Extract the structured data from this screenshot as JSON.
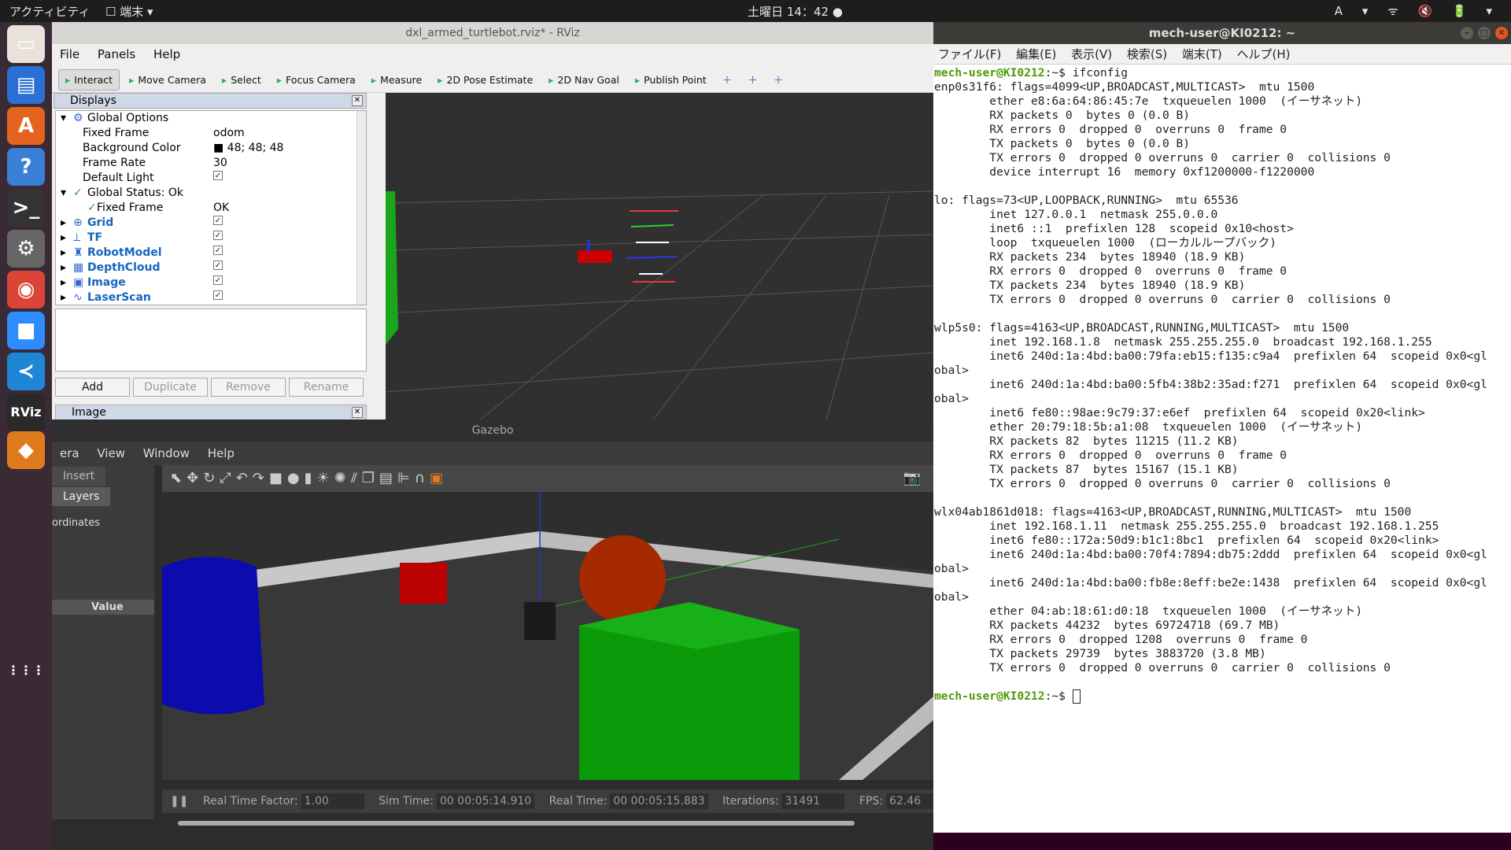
{
  "topbar": {
    "activities": "アクティビティ",
    "app": "☐ 端末 ▾",
    "clock": "土曜日 14：42 ●",
    "status": "A ▾  ᯤ 🔇 🔋 ▾"
  },
  "dock": [
    {
      "name": "files-icon",
      "g": "▭",
      "c": "#e8e2da"
    },
    {
      "name": "writer-icon",
      "g": "▤",
      "c": "#2a6fd4"
    },
    {
      "name": "software-icon",
      "g": "A",
      "c": "#e2641e"
    },
    {
      "name": "help-icon",
      "g": "?",
      "c": "#3a7fd6"
    },
    {
      "name": "terminal-icon",
      "g": ">_",
      "c": "#333"
    },
    {
      "name": "settings-icon",
      "g": "⚙",
      "c": "#666"
    },
    {
      "name": "chrome-icon",
      "g": "◉",
      "c": "#db4437"
    },
    {
      "name": "zoom-icon",
      "g": "■",
      "c": "#2d8cff"
    },
    {
      "name": "vscode-icon",
      "g": "≺",
      "c": "#1f86d6"
    },
    {
      "name": "rviz-icon",
      "g": "RViz",
      "c": "#2a2a2a"
    },
    {
      "name": "gazebo-icon",
      "g": "◆",
      "c": "#e07b1d"
    },
    {
      "name": "apps-grid-icon",
      "g": "⋮⋮⋮",
      "c": "#3a2a36"
    }
  ],
  "rviz": {
    "title": "dxl_armed_turtlebot.rviz* - RViz",
    "menu": [
      "File",
      "Panels",
      "Help"
    ],
    "tools": [
      "Interact",
      "Move Camera",
      "Select",
      "Focus Camera",
      "Measure",
      "2D Pose Estimate",
      "2D Nav Goal",
      "Publish Point"
    ],
    "tool_icons": [
      "cursor-icon",
      "move-camera-icon",
      "select-icon",
      "focus-camera-icon",
      "measure-icon",
      "pose-estimate-icon",
      "nav-goal-icon",
      "publish-point-icon"
    ],
    "displays_title": "Displays",
    "tree": [
      {
        "n": "Global Options",
        "v": "",
        "d": 0,
        "arrow": "▾",
        "icon": "⚙"
      },
      {
        "n": "Fixed Frame",
        "v": "odom",
        "d": 1
      },
      {
        "n": "Background Color",
        "v": "■ 48; 48; 48",
        "d": 1
      },
      {
        "n": "Frame Rate",
        "v": "30",
        "d": 1
      },
      {
        "n": "Default Light",
        "v": "✓",
        "d": 1,
        "chk": true
      },
      {
        "n": "Global Status: Ok",
        "v": "",
        "d": 0,
        "arrow": "▾",
        "icon": "✓"
      },
      {
        "n": "Fixed Frame",
        "v": "OK",
        "d": 1,
        "icon": "✓"
      },
      {
        "n": "Grid",
        "v": "✓",
        "d": 0,
        "arrow": "▸",
        "icon": "⊕",
        "lk": true,
        "chk": true
      },
      {
        "n": "TF",
        "v": "✓",
        "d": 0,
        "arrow": "▸",
        "icon": "⟂",
        "lk": true,
        "chk": true
      },
      {
        "n": "RobotModel",
        "v": "✓",
        "d": 0,
        "arrow": "▸",
        "icon": "♜",
        "lk": true,
        "chk": true
      },
      {
        "n": "DepthCloud",
        "v": "✓",
        "d": 0,
        "arrow": "▸",
        "icon": "▦",
        "lk": true,
        "chk": true
      },
      {
        "n": "Image",
        "v": "✓",
        "d": 0,
        "arrow": "▸",
        "icon": "▣",
        "lk": true,
        "chk": true
      },
      {
        "n": "LaserScan",
        "v": "✓",
        "d": 0,
        "arrow": "▸",
        "icon": "∿",
        "lk": true,
        "chk": true
      }
    ],
    "buttons": [
      "Add",
      "Duplicate",
      "Remove",
      "Rename"
    ],
    "image_panel": "Image"
  },
  "gazebo": {
    "title": "Gazebo",
    "menu": [
      "era",
      "View",
      "Window",
      "Help"
    ],
    "tabs": [
      "Insert",
      "Layers"
    ],
    "left_items": [
      "ordinates",
      "Value"
    ],
    "rtf_label": "Real Time Factor:",
    "rtf": "1.00",
    "sim_label": "Sim Time:",
    "sim": "00 00:05:14.910",
    "real_label": "Real Time:",
    "real": "00 00:05:15.883",
    "iter_label": "Iterations:",
    "iter": "31491",
    "fps_label": "FPS:",
    "fps": "62.46"
  },
  "terminal": {
    "title": "mech-user@KI0212: ~",
    "menu": [
      "ファイル(F)",
      "編集(E)",
      "表示(V)",
      "検索(S)",
      "端末(T)",
      "ヘルプ(H)"
    ],
    "prompt": "mech-user@KI0212",
    "cmd": ":~$ ifconfig",
    "lines": [
      "enp0s31f6: flags=4099<UP,BROADCAST,MULTICAST>  mtu 1500",
      "        ether e8:6a:64:86:45:7e  txqueuelen 1000  (イーサネット)",
      "        RX packets 0  bytes 0 (0.0 B)",
      "        RX errors 0  dropped 0  overruns 0  frame 0",
      "        TX packets 0  bytes 0 (0.0 B)",
      "        TX errors 0  dropped 0 overruns 0  carrier 0  collisions 0",
      "        device interrupt 16  memory 0xf1200000-f1220000",
      "",
      "lo: flags=73<UP,LOOPBACK,RUNNING>  mtu 65536",
      "        inet 127.0.0.1  netmask 255.0.0.0",
      "        inet6 ::1  prefixlen 128  scopeid 0x10<host>",
      "        loop  txqueuelen 1000  (ローカルループバック)",
      "        RX packets 234  bytes 18940 (18.9 KB)",
      "        RX errors 0  dropped 0  overruns 0  frame 0",
      "        TX packets 234  bytes 18940 (18.9 KB)",
      "        TX errors 0  dropped 0 overruns 0  carrier 0  collisions 0",
      "",
      "wlp5s0: flags=4163<UP,BROADCAST,RUNNING,MULTICAST>  mtu 1500",
      "        inet 192.168.1.8  netmask 255.255.255.0  broadcast 192.168.1.255",
      "        inet6 240d:1a:4bd:ba00:79fa:eb15:f135:c9a4  prefixlen 64  scopeid 0x0<gl",
      "obal>",
      "        inet6 240d:1a:4bd:ba00:5fb4:38b2:35ad:f271  prefixlen 64  scopeid 0x0<gl",
      "obal>",
      "        inet6 fe80::98ae:9c79:37:e6ef  prefixlen 64  scopeid 0x20<link>",
      "        ether 20:79:18:5b:a1:08  txqueuelen 1000  (イーサネット)",
      "        RX packets 82  bytes 11215 (11.2 KB)",
      "        RX errors 0  dropped 0  overruns 0  frame 0",
      "        TX packets 87  bytes 15167 (15.1 KB)",
      "        TX errors 0  dropped 0 overruns 0  carrier 0  collisions 0",
      "",
      "wlx04ab1861d018: flags=4163<UP,BROADCAST,RUNNING,MULTICAST>  mtu 1500",
      "        inet 192.168.1.11  netmask 255.255.255.0  broadcast 192.168.1.255",
      "        inet6 fe80::172a:50d9:b1c1:8bc1  prefixlen 64  scopeid 0x20<link>",
      "        inet6 240d:1a:4bd:ba00:70f4:7894:db75:2ddd  prefixlen 64  scopeid 0x0<gl",
      "obal>",
      "        inet6 240d:1a:4bd:ba00:fb8e:8eff:be2e:1438  prefixlen 64  scopeid 0x0<gl",
      "obal>",
      "        ether 04:ab:18:61:d0:18  txqueuelen 1000  (イーサネット)",
      "        RX packets 44232  bytes 69724718 (69.7 MB)",
      "        RX errors 0  dropped 1208  overruns 0  frame 0",
      "        TX packets 29739  bytes 3883720 (3.8 MB)",
      "        TX errors 0  dropped 0 overruns 0  carrier 0  collisions 0",
      ""
    ],
    "prompt_tail": ":~$ "
  }
}
